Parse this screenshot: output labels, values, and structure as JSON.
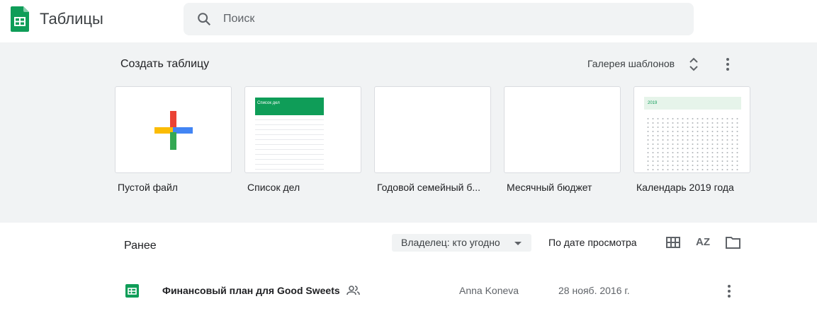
{
  "header": {
    "app_title": "Таблицы",
    "search_placeholder": "Поиск"
  },
  "templates": {
    "title": "Создать таблицу",
    "gallery_label": "Галерея шаблонов",
    "items": [
      {
        "label": "Пустой файл"
      },
      {
        "label": "Список дел",
        "preview_title": "Список дел"
      },
      {
        "label": "Годовой семейный б..."
      },
      {
        "label": "Месячный бюджет"
      },
      {
        "label": "Календарь 2019 года",
        "preview_title": "2019"
      }
    ]
  },
  "recent": {
    "title": "Ранее",
    "owner_filter": "Владелец: кто угодно",
    "sort_label": "По дате просмотра",
    "files": [
      {
        "name": "Финансовый план для Good Sweets",
        "owner": "Anna Koneva",
        "date": "28 нояб. 2016 г."
      }
    ]
  },
  "colors": {
    "brand_green": "#0f9d58",
    "panel_bg": "#f1f3f4"
  }
}
